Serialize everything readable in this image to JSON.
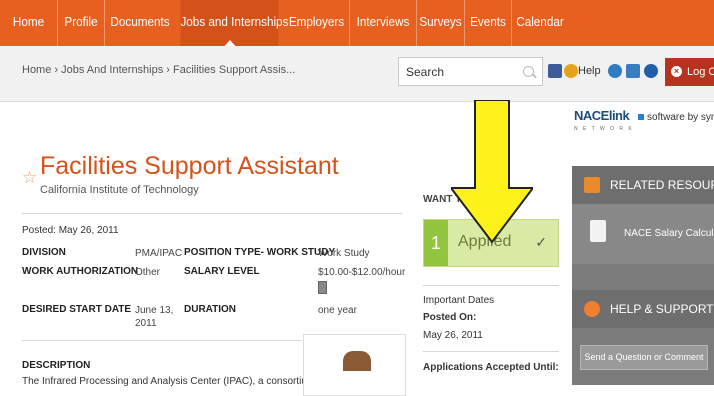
{
  "nav": {
    "items": [
      "Home",
      "Profile",
      "Documents",
      "Jobs and Internships",
      "Employers",
      "Interviews",
      "Surveys",
      "Events",
      "Calendar"
    ],
    "active_index": 3
  },
  "breadcrumb": "Home › Jobs And Internships › Facilities Support Assis...",
  "search": {
    "value": "Search"
  },
  "toolbar": {
    "help": "Help",
    "logout": "Log Out"
  },
  "branding": {
    "logo": "NACElink",
    "software": "software by symplicity",
    "logo_sub": "N E T W O R K"
  },
  "job": {
    "title": "Facilities Support Assistant",
    "employer": "California Institute of Technology",
    "posted": "Posted: May 26, 2011",
    "details": {
      "division_label": "DIVISION",
      "division_value": "PMA/IPAC",
      "position_type_label": "POSITION TYPE- WORK STUDY",
      "position_type_value": "Work Study",
      "work_auth_label": "WORK AUTHORIZATION",
      "work_auth_value": "Other",
      "salary_label": "SALARY LEVEL",
      "salary_value": "$10.00-$12.00/hour",
      "start_label": "DESIRED START DATE",
      "start_value_1": "June 13,",
      "start_value_2": "2011",
      "duration_label": "DURATION",
      "duration_value": "one year"
    },
    "description_label": "DESCRIPTION",
    "description_text": "The Infrared Processing and Analysis Center (IPAC), a consortium"
  },
  "apply": {
    "want_label": "WANT THIS JOB?",
    "step_number": "1",
    "status": "Applied",
    "check": "✓"
  },
  "important_dates": {
    "heading": "Important Dates",
    "posted_label": "Posted On:",
    "posted_value": "May 26, 2011",
    "accepted_label": "Applications Accepted Until:"
  },
  "sidebar": {
    "related_heading": "RELATED RESOURCES",
    "salary_calc": "NACE Salary Calculator",
    "help_heading": "HELP & SUPPORT",
    "question_button": "Send a Question or Comment"
  },
  "colors": {
    "brand_orange": "#e8601f",
    "applied_green": "#93c43e",
    "arrow_yellow": "#fff21a"
  }
}
